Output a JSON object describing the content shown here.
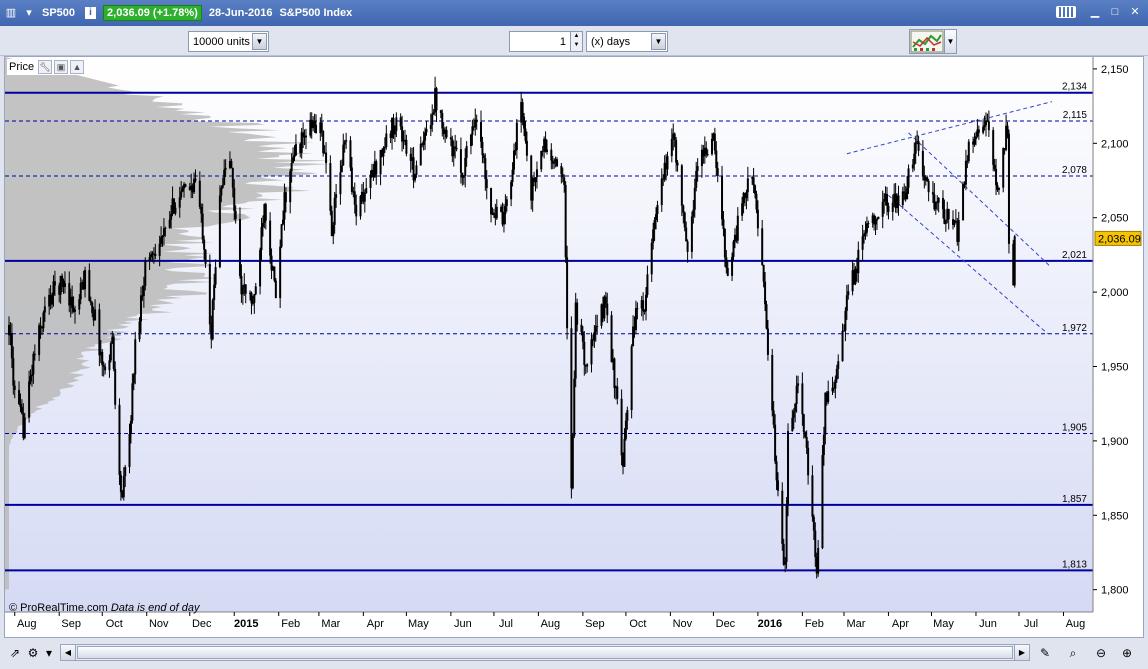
{
  "window": {
    "symbol": "SP500",
    "price_badge": "2,036.09 (+1.78%)",
    "date": "28-Jun-2016",
    "instrument": "S&P500 Index"
  },
  "toolbar": {
    "units": "10000 units",
    "period_value": "1",
    "period_unit": "(x) days"
  },
  "panel": {
    "price_label": "Price"
  },
  "footer": {
    "copyright": "© ProRealTime.com",
    "note": "Data is end of day"
  },
  "colors": {
    "level_line": "#0000a0",
    "candle": "#000000",
    "volume_profile": "#bcbcbc",
    "current_price_bg": "#f6c400",
    "trend_line": "#3344c8"
  },
  "icons": {
    "window": "chart-window-icon",
    "info": "info-icon",
    "keyboard": "keyboard-icon",
    "chart_type": "chart-type-icon",
    "wrench": "wrench-icon"
  },
  "chart_data": {
    "type": "line",
    "style": "candlestick",
    "ylim": [
      1785,
      2158
    ],
    "y_ticks": [
      {
        "value": 2150,
        "label": "2,150"
      },
      {
        "value": 2100,
        "label": "2,100"
      },
      {
        "value": 2050,
        "label": "2,050"
      },
      {
        "value": 2000,
        "label": "2,000"
      },
      {
        "value": 1950,
        "label": "1,950"
      },
      {
        "value": 1900,
        "label": "1,900"
      },
      {
        "value": 1850,
        "label": "1,850"
      },
      {
        "value": 1800,
        "label": "1,800"
      }
    ],
    "x_ticks": [
      {
        "label": "Aug",
        "bold": false
      },
      {
        "label": "Sep",
        "bold": false
      },
      {
        "label": "Oct",
        "bold": false
      },
      {
        "label": "Nov",
        "bold": false
      },
      {
        "label": "Dec",
        "bold": false
      },
      {
        "label": "2015",
        "bold": true
      },
      {
        "label": "Feb",
        "bold": false
      },
      {
        "label": "Mar",
        "bold": false
      },
      {
        "label": "Apr",
        "bold": false
      },
      {
        "label": "May",
        "bold": false
      },
      {
        "label": "Jun",
        "bold": false
      },
      {
        "label": "Jul",
        "bold": false
      },
      {
        "label": "Aug",
        "bold": false
      },
      {
        "label": "Sep",
        "bold": false
      },
      {
        "label": "Oct",
        "bold": false
      },
      {
        "label": "Nov",
        "bold": false
      },
      {
        "label": "Dec",
        "bold": false
      },
      {
        "label": "2016",
        "bold": true
      },
      {
        "label": "Feb",
        "bold": false
      },
      {
        "label": "Mar",
        "bold": false
      },
      {
        "label": "Apr",
        "bold": false
      },
      {
        "label": "May",
        "bold": false
      },
      {
        "label": "Jun",
        "bold": false
      },
      {
        "label": "Jul",
        "bold": false
      },
      {
        "label": "Aug",
        "bold": false
      }
    ],
    "levels": [
      {
        "value": 2134,
        "label": "2,134",
        "style": "solid"
      },
      {
        "value": 2115,
        "label": "2,115",
        "style": "dashed"
      },
      {
        "value": 2078,
        "label": "2,078",
        "style": "dashed"
      },
      {
        "value": 2021,
        "label": "2,021",
        "style": "solid"
      },
      {
        "value": 1972,
        "label": "1,972",
        "style": "dashed"
      },
      {
        "value": 1905,
        "label": "1,905",
        "style": "dashed"
      },
      {
        "value": 1857,
        "label": "1,857",
        "style": "solid"
      },
      {
        "value": 1813,
        "label": "1,813",
        "style": "solid"
      }
    ],
    "current_price": {
      "value": 2036.09,
      "label": "2,036.09"
    },
    "price_path": [
      [
        "2014-07-28",
        1978
      ],
      [
        "2014-08-01",
        1930
      ],
      [
        "2014-08-07",
        1909
      ],
      [
        "2014-08-14",
        1955
      ],
      [
        "2014-08-22",
        1988
      ],
      [
        "2014-08-29",
        2003
      ],
      [
        "2014-09-05",
        2007
      ],
      [
        "2014-09-12",
        1985
      ],
      [
        "2014-09-19",
        2011
      ],
      [
        "2014-09-26",
        1982
      ],
      [
        "2014-10-02",
        1946
      ],
      [
        "2014-10-08",
        1968
      ],
      [
        "2014-10-13",
        1874
      ],
      [
        "2014-10-15",
        1862
      ],
      [
        "2014-10-20",
        1904
      ],
      [
        "2014-10-24",
        1964
      ],
      [
        "2014-10-31",
        2018
      ],
      [
        "2014-11-07",
        2031
      ],
      [
        "2014-11-14",
        2039
      ],
      [
        "2014-11-21",
        2063
      ],
      [
        "2014-11-28",
        2067
      ],
      [
        "2014-12-05",
        2075
      ],
      [
        "2014-12-11",
        2035
      ],
      [
        "2014-12-16",
        1972
      ],
      [
        "2014-12-22",
        2070
      ],
      [
        "2014-12-29",
        2090
      ],
      [
        "2015-01-06",
        2003
      ],
      [
        "2015-01-15",
        1992
      ],
      [
        "2015-01-22",
        2063
      ],
      [
        "2015-01-30",
        1995
      ],
      [
        "2015-02-05",
        2062
      ],
      [
        "2015-02-13",
        2096
      ],
      [
        "2015-02-25",
        2113
      ],
      [
        "2015-03-03",
        2108
      ],
      [
        "2015-03-10",
        2044
      ],
      [
        "2015-03-16",
        2081
      ],
      [
        "2015-03-20",
        2108
      ],
      [
        "2015-03-26",
        2056
      ],
      [
        "2015-04-02",
        2066
      ],
      [
        "2015-04-14",
        2095
      ],
      [
        "2015-04-24",
        2117
      ],
      [
        "2015-05-06",
        2081
      ],
      [
        "2015-05-13",
        2099
      ],
      [
        "2015-05-21",
        2131
      ],
      [
        "2015-05-29",
        2107
      ],
      [
        "2015-06-09",
        2080
      ],
      [
        "2015-06-18",
        2121
      ],
      [
        "2015-06-29",
        2057
      ],
      [
        "2015-07-08",
        2046
      ],
      [
        "2015-07-20",
        2128
      ],
      [
        "2015-07-27",
        2067
      ],
      [
        "2015-08-05",
        2099
      ],
      [
        "2015-08-13",
        2083
      ],
      [
        "2015-08-19",
        2079
      ],
      [
        "2015-08-21",
        1970
      ],
      [
        "2015-08-24",
        1867
      ],
      [
        "2015-08-27",
        1988
      ],
      [
        "2015-09-03",
        1951
      ],
      [
        "2015-09-17",
        1995
      ],
      [
        "2015-09-24",
        1932
      ],
      [
        "2015-09-29",
        1881
      ],
      [
        "2015-10-06",
        1979
      ],
      [
        "2015-10-14",
        1994
      ],
      [
        "2015-10-22",
        2052
      ],
      [
        "2015-11-03",
        2109
      ],
      [
        "2015-11-13",
        2023
      ],
      [
        "2015-11-20",
        2089
      ],
      [
        "2015-12-01",
        2102
      ],
      [
        "2015-12-11",
        2012
      ],
      [
        "2015-12-17",
        2041
      ],
      [
        "2015-12-22",
        2064
      ],
      [
        "2015-12-29",
        2078
      ],
      [
        "2016-01-06",
        1990
      ],
      [
        "2016-01-13",
        1890
      ],
      [
        "2016-01-20",
        1812
      ],
      [
        "2016-01-22",
        1906
      ],
      [
        "2016-01-29",
        1940
      ],
      [
        "2016-02-05",
        1880
      ],
      [
        "2016-02-11",
        1810
      ],
      [
        "2016-02-17",
        1926
      ],
      [
        "2016-02-26",
        1948
      ],
      [
        "2016-03-04",
        1999
      ],
      [
        "2016-03-11",
        2022
      ],
      [
        "2016-03-18",
        2049
      ],
      [
        "2016-03-31",
        2060
      ],
      [
        "2016-04-12",
        2061
      ],
      [
        "2016-04-20",
        2102
      ],
      [
        "2016-04-29",
        2065
      ],
      [
        "2016-05-06",
        2057
      ],
      [
        "2016-05-19",
        2040
      ],
      [
        "2016-05-27",
        2099
      ],
      [
        "2016-06-08",
        2119
      ],
      [
        "2016-06-13",
        2079
      ],
      [
        "2016-06-17",
        2071
      ],
      [
        "2016-06-23",
        2113
      ],
      [
        "2016-06-24",
        2037
      ],
      [
        "2016-06-27",
        2000
      ],
      [
        "2016-06-28",
        2036
      ]
    ]
  }
}
